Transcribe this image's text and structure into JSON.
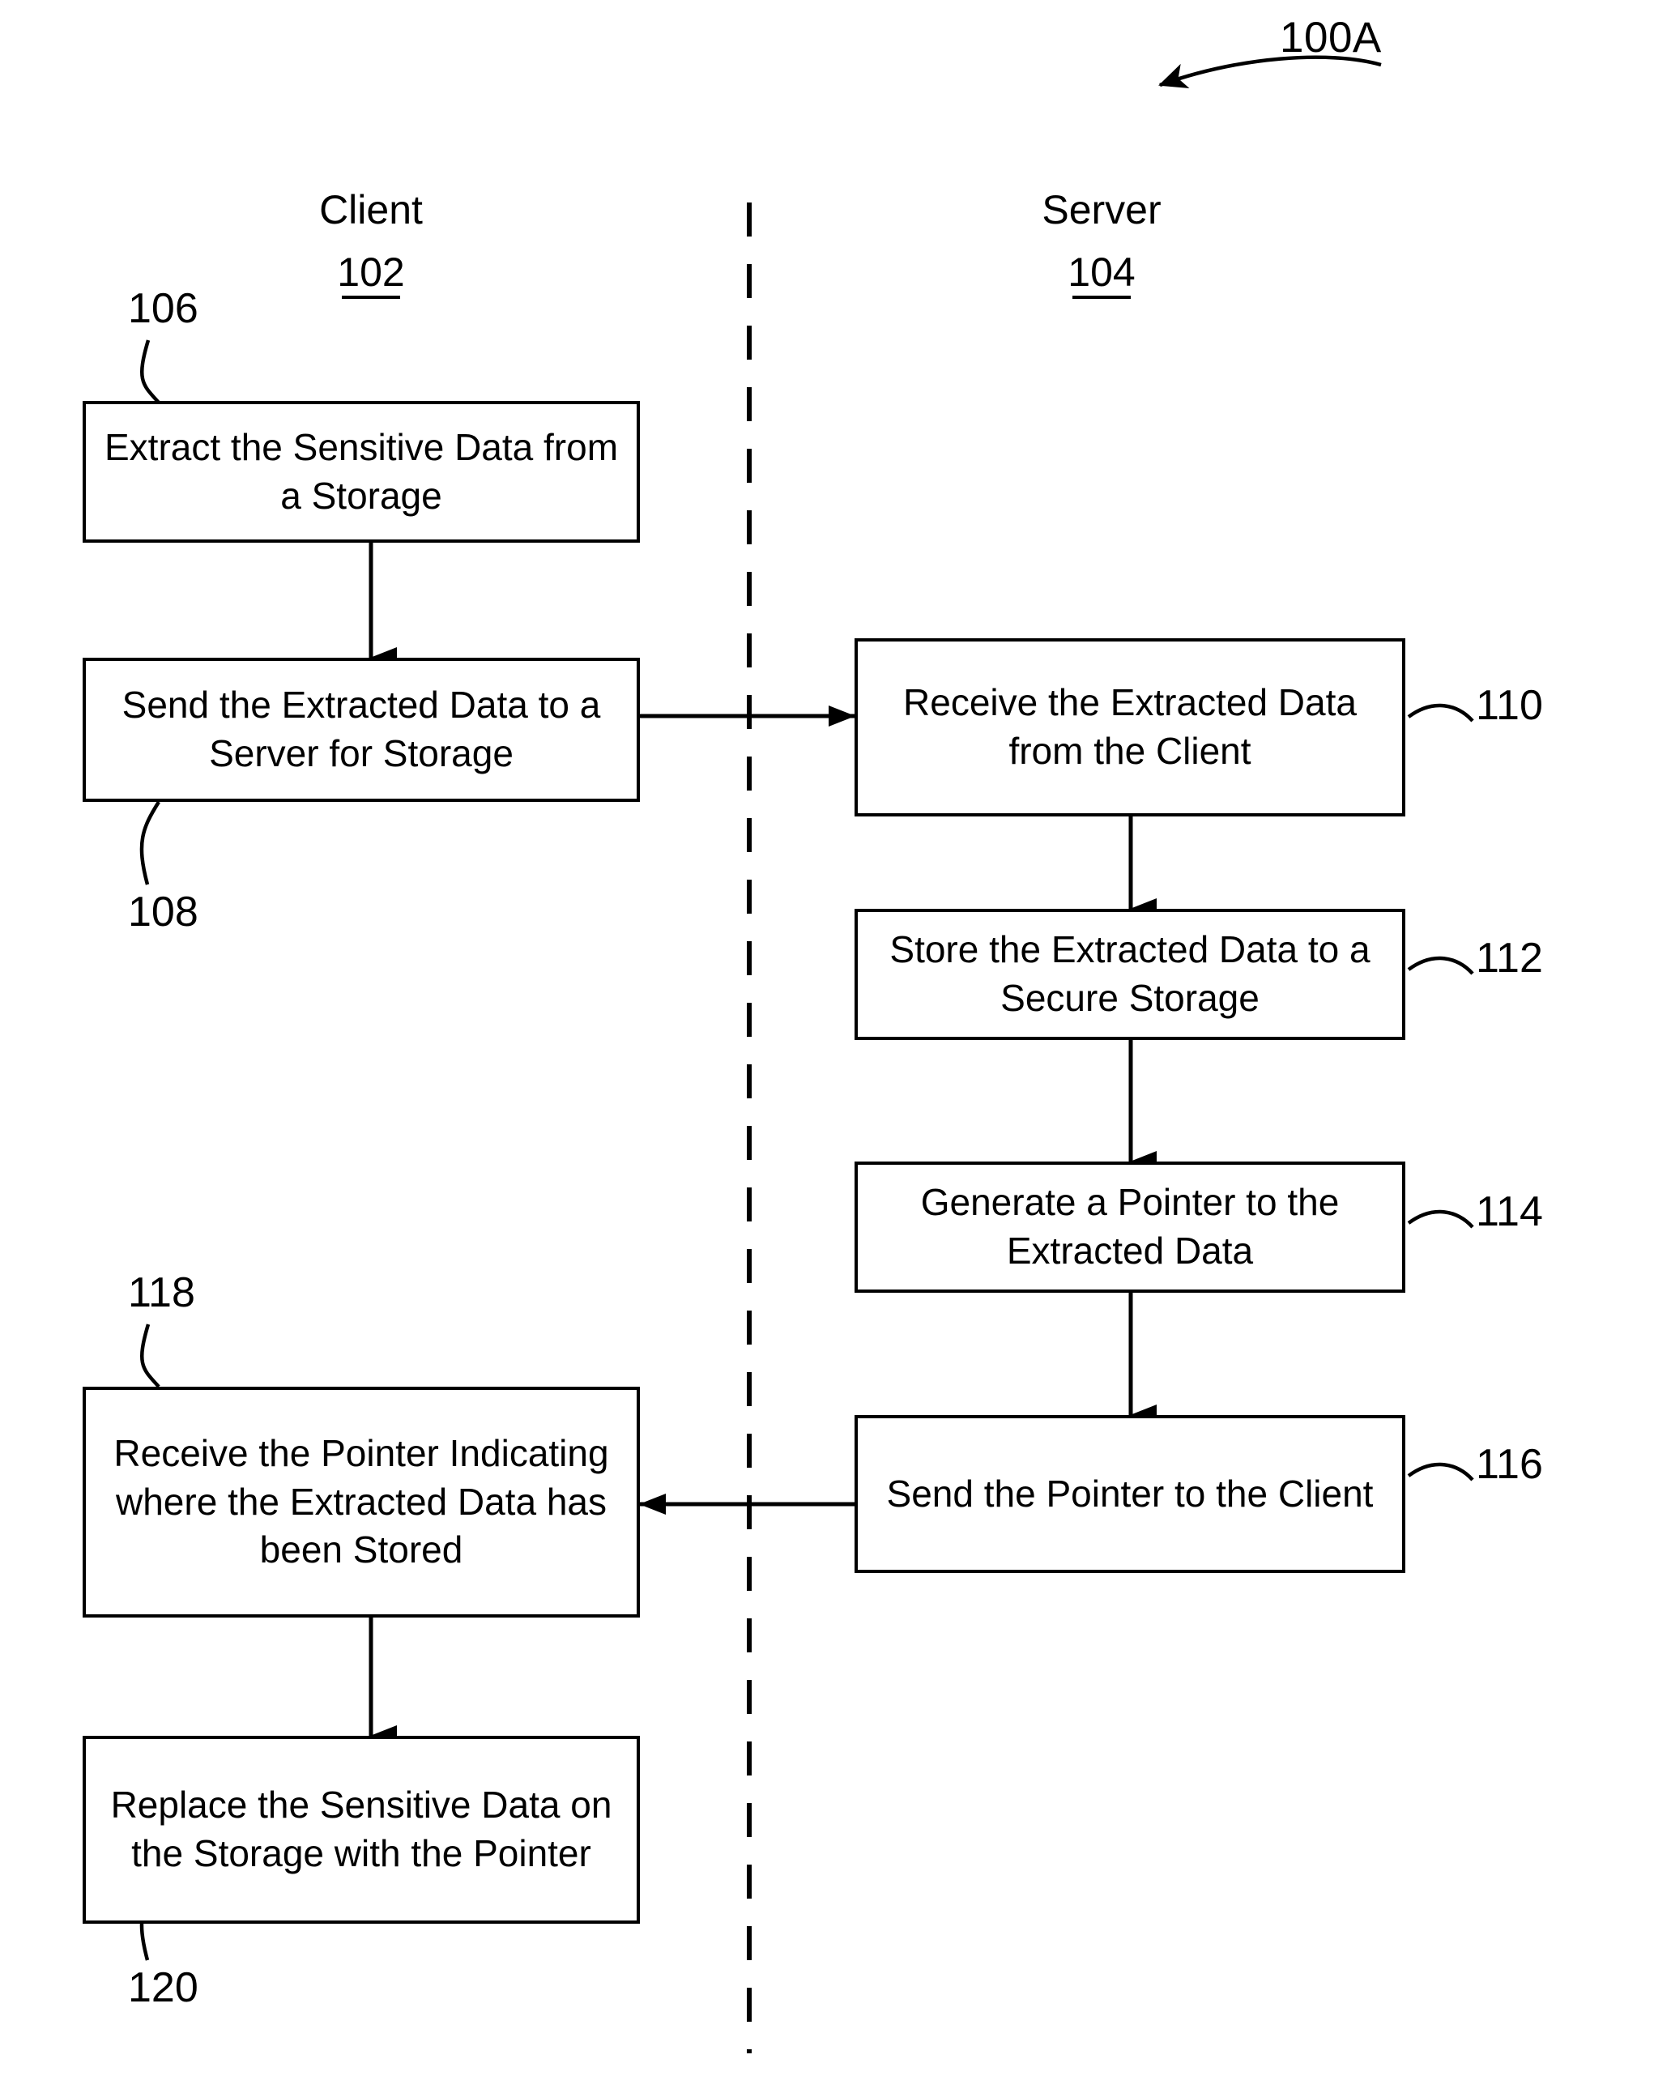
{
  "figure": {
    "label": "100A"
  },
  "columns": [
    {
      "id": "client",
      "title": "Client",
      "number": "102"
    },
    {
      "id": "server",
      "title": "Server",
      "number": "104"
    }
  ],
  "divider": {
    "name": "client-server-divider",
    "style": "dashed-vertical"
  },
  "steps": [
    {
      "ref": "106",
      "lane": "client",
      "text": "Extract the Sensitive Data from a Storage",
      "lines": [
        "Extract the Sensitive Data",
        "from a Storage"
      ]
    },
    {
      "ref": "108",
      "lane": "client",
      "text": "Send the Extracted Data to a Server for Storage",
      "lines": [
        "Send the Extracted Data to",
        "a Server for Storage"
      ]
    },
    {
      "ref": "110",
      "lane": "server",
      "text": "Receive the Extracted Data from the Client",
      "lines": [
        "Receive the Extracted Data",
        "from the Client"
      ]
    },
    {
      "ref": "112",
      "lane": "server",
      "text": "Store the Extracted Data to a Secure Storage",
      "lines": [
        "Store the Extracted Data to",
        "a Secure Storage"
      ]
    },
    {
      "ref": "114",
      "lane": "server",
      "text": "Generate a Pointer to the Extracted Data",
      "lines": [
        "Generate a Pointer to the",
        "Extracted Data"
      ]
    },
    {
      "ref": "116",
      "lane": "server",
      "text": "Send the Pointer to the Client",
      "lines": [
        "Send the Pointer to the",
        "Client"
      ]
    },
    {
      "ref": "118",
      "lane": "client",
      "text": "Receive the Pointer Indicating where the Extracted Data has been Stored",
      "lines": [
        "Receive the Pointer",
        "Indicating where the",
        "Extracted Data has been",
        "Stored"
      ]
    },
    {
      "ref": "120",
      "lane": "client",
      "text": "Replace the Sensitive Data on the Storage with the Pointer",
      "lines": [
        "Replace the Sensitive Data",
        "on the Storage with the",
        "Pointer"
      ]
    }
  ],
  "connectors": [
    {
      "name": "arrow-106-to-108",
      "from": "106",
      "to": "108",
      "direction": "down"
    },
    {
      "name": "arrow-108-to-110",
      "from": "108",
      "to": "110",
      "direction": "right"
    },
    {
      "name": "arrow-110-to-112",
      "from": "110",
      "to": "112",
      "direction": "down"
    },
    {
      "name": "arrow-112-to-114",
      "from": "112",
      "to": "114",
      "direction": "down"
    },
    {
      "name": "arrow-114-to-116",
      "from": "114",
      "to": "116",
      "direction": "down"
    },
    {
      "name": "arrow-116-to-118",
      "from": "116",
      "to": "118",
      "direction": "left"
    },
    {
      "name": "arrow-118-to-120",
      "from": "118",
      "to": "120",
      "direction": "down"
    }
  ],
  "colors": {
    "stroke": "#000000",
    "background": "#ffffff"
  }
}
